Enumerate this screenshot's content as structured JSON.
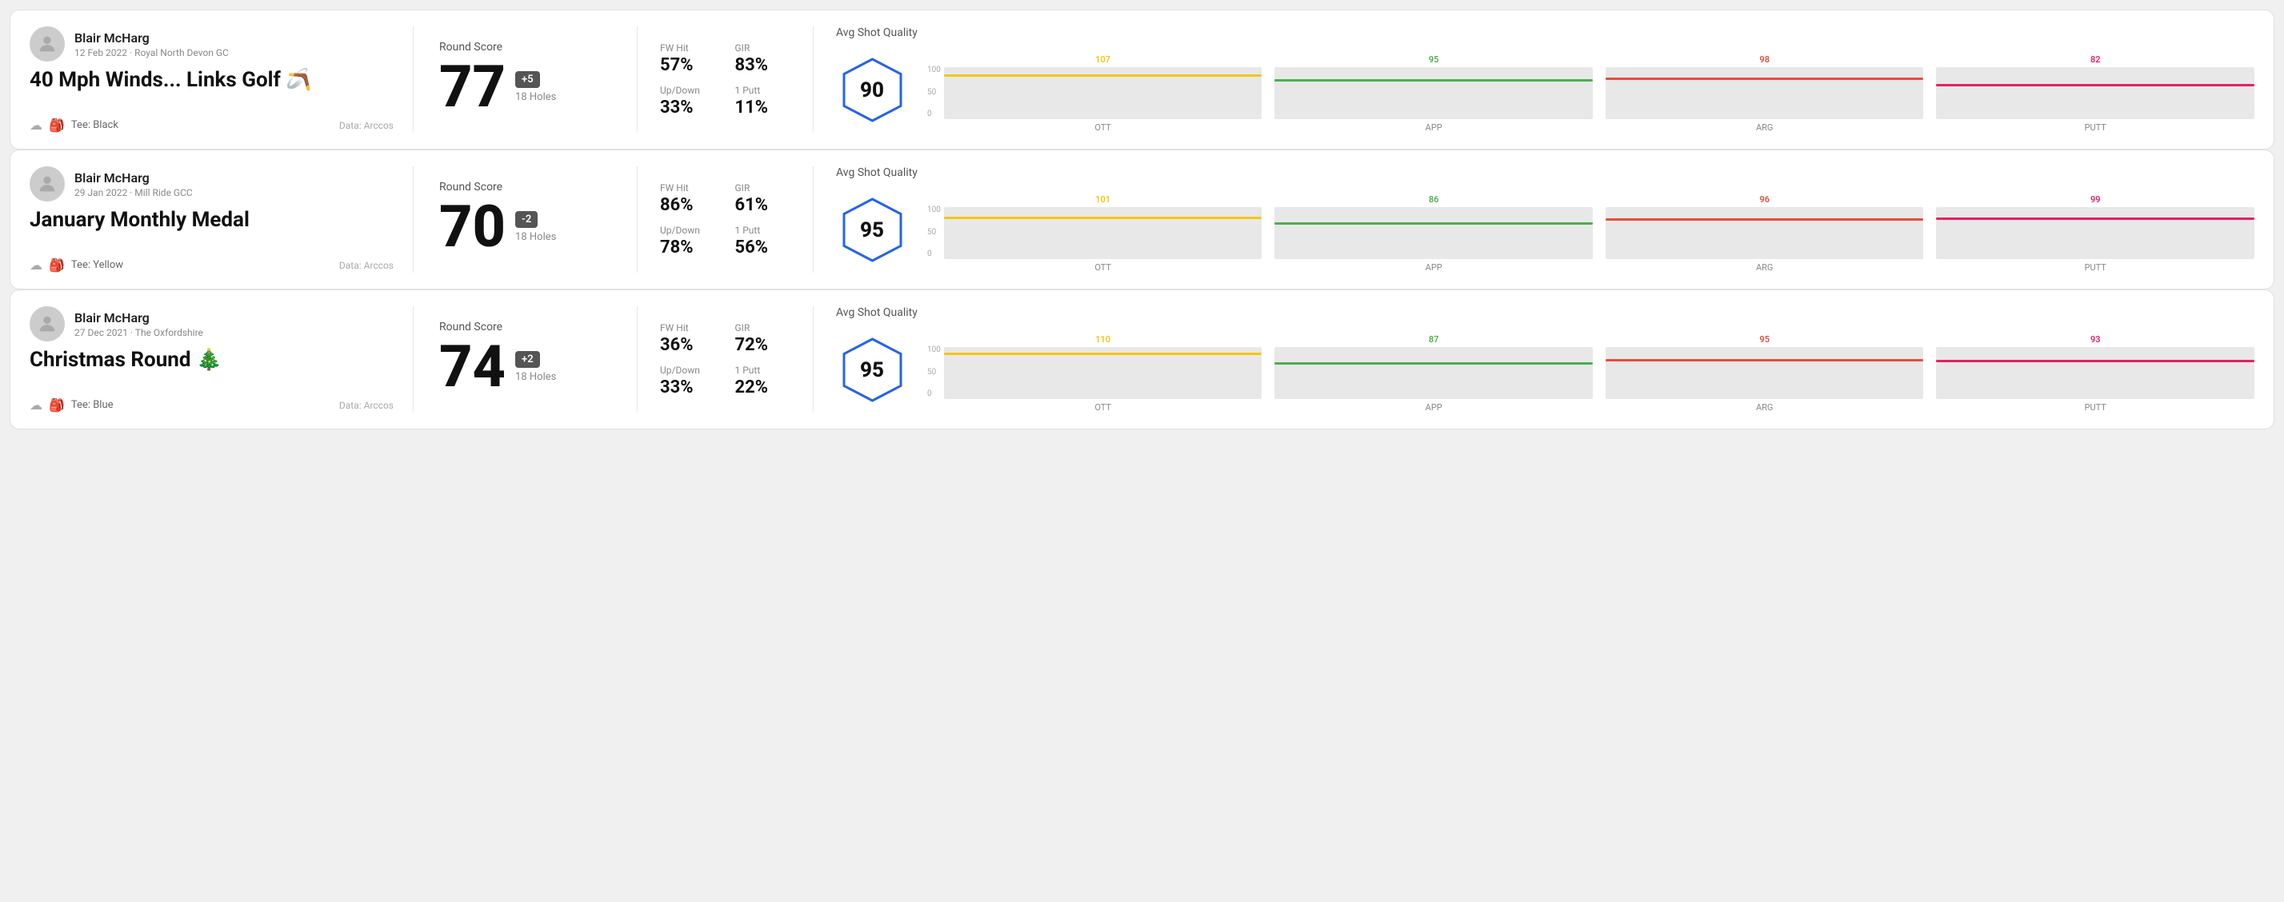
{
  "rounds": [
    {
      "id": "round1",
      "user": {
        "name": "Blair McHarg",
        "date": "12 Feb 2022",
        "venue": "Royal North Devon GC"
      },
      "title": "40 Mph Winds... Links Golf 🪃",
      "tee": "Black",
      "data_source": "Data: Arccos",
      "score": "77",
      "score_diff": "+5",
      "score_diff_type": "over",
      "holes": "18 Holes",
      "fw_hit": "57%",
      "gir": "83%",
      "up_down": "33%",
      "one_putt": "11%",
      "avg_quality": "90",
      "bars": [
        {
          "label": "OTT",
          "value": 107,
          "color": "#f5c518"
        },
        {
          "label": "APP",
          "value": 95,
          "color": "#4CAF50"
        },
        {
          "label": "ARG",
          "value": 98,
          "color": "#e74c3c"
        },
        {
          "label": "PUTT",
          "value": 82,
          "color": "#e91e63"
        }
      ],
      "y_labels": [
        "100",
        "50",
        "0"
      ]
    },
    {
      "id": "round2",
      "user": {
        "name": "Blair McHarg",
        "date": "29 Jan 2022",
        "venue": "Mill Ride GCC"
      },
      "title": "January Monthly Medal",
      "tee": "Yellow",
      "data_source": "Data: Arccos",
      "score": "70",
      "score_diff": "-2",
      "score_diff_type": "under",
      "holes": "18 Holes",
      "fw_hit": "86%",
      "gir": "61%",
      "up_down": "78%",
      "one_putt": "56%",
      "avg_quality": "95",
      "bars": [
        {
          "label": "OTT",
          "value": 101,
          "color": "#f5c518"
        },
        {
          "label": "APP",
          "value": 86,
          "color": "#4CAF50"
        },
        {
          "label": "ARG",
          "value": 96,
          "color": "#e74c3c"
        },
        {
          "label": "PUTT",
          "value": 99,
          "color": "#e91e63"
        }
      ],
      "y_labels": [
        "100",
        "50",
        "0"
      ]
    },
    {
      "id": "round3",
      "user": {
        "name": "Blair McHarg",
        "date": "27 Dec 2021",
        "venue": "The Oxfordshire"
      },
      "title": "Christmas Round 🎄",
      "tee": "Blue",
      "data_source": "Data: Arccos",
      "score": "74",
      "score_diff": "+2",
      "score_diff_type": "over",
      "holes": "18 Holes",
      "fw_hit": "36%",
      "gir": "72%",
      "up_down": "33%",
      "one_putt": "22%",
      "avg_quality": "95",
      "bars": [
        {
          "label": "OTT",
          "value": 110,
          "color": "#f5c518"
        },
        {
          "label": "APP",
          "value": 87,
          "color": "#4CAF50"
        },
        {
          "label": "ARG",
          "value": 95,
          "color": "#e74c3c"
        },
        {
          "label": "PUTT",
          "value": 93,
          "color": "#e91e63"
        }
      ],
      "y_labels": [
        "100",
        "50",
        "0"
      ]
    }
  ],
  "labels": {
    "round_score": "Round Score",
    "fw_hit": "FW Hit",
    "gir": "GIR",
    "up_down": "Up/Down",
    "one_putt": "1 Putt",
    "avg_quality": "Avg Shot Quality",
    "data_arccos": "Data: Arccos",
    "tee_prefix": "Tee:"
  }
}
